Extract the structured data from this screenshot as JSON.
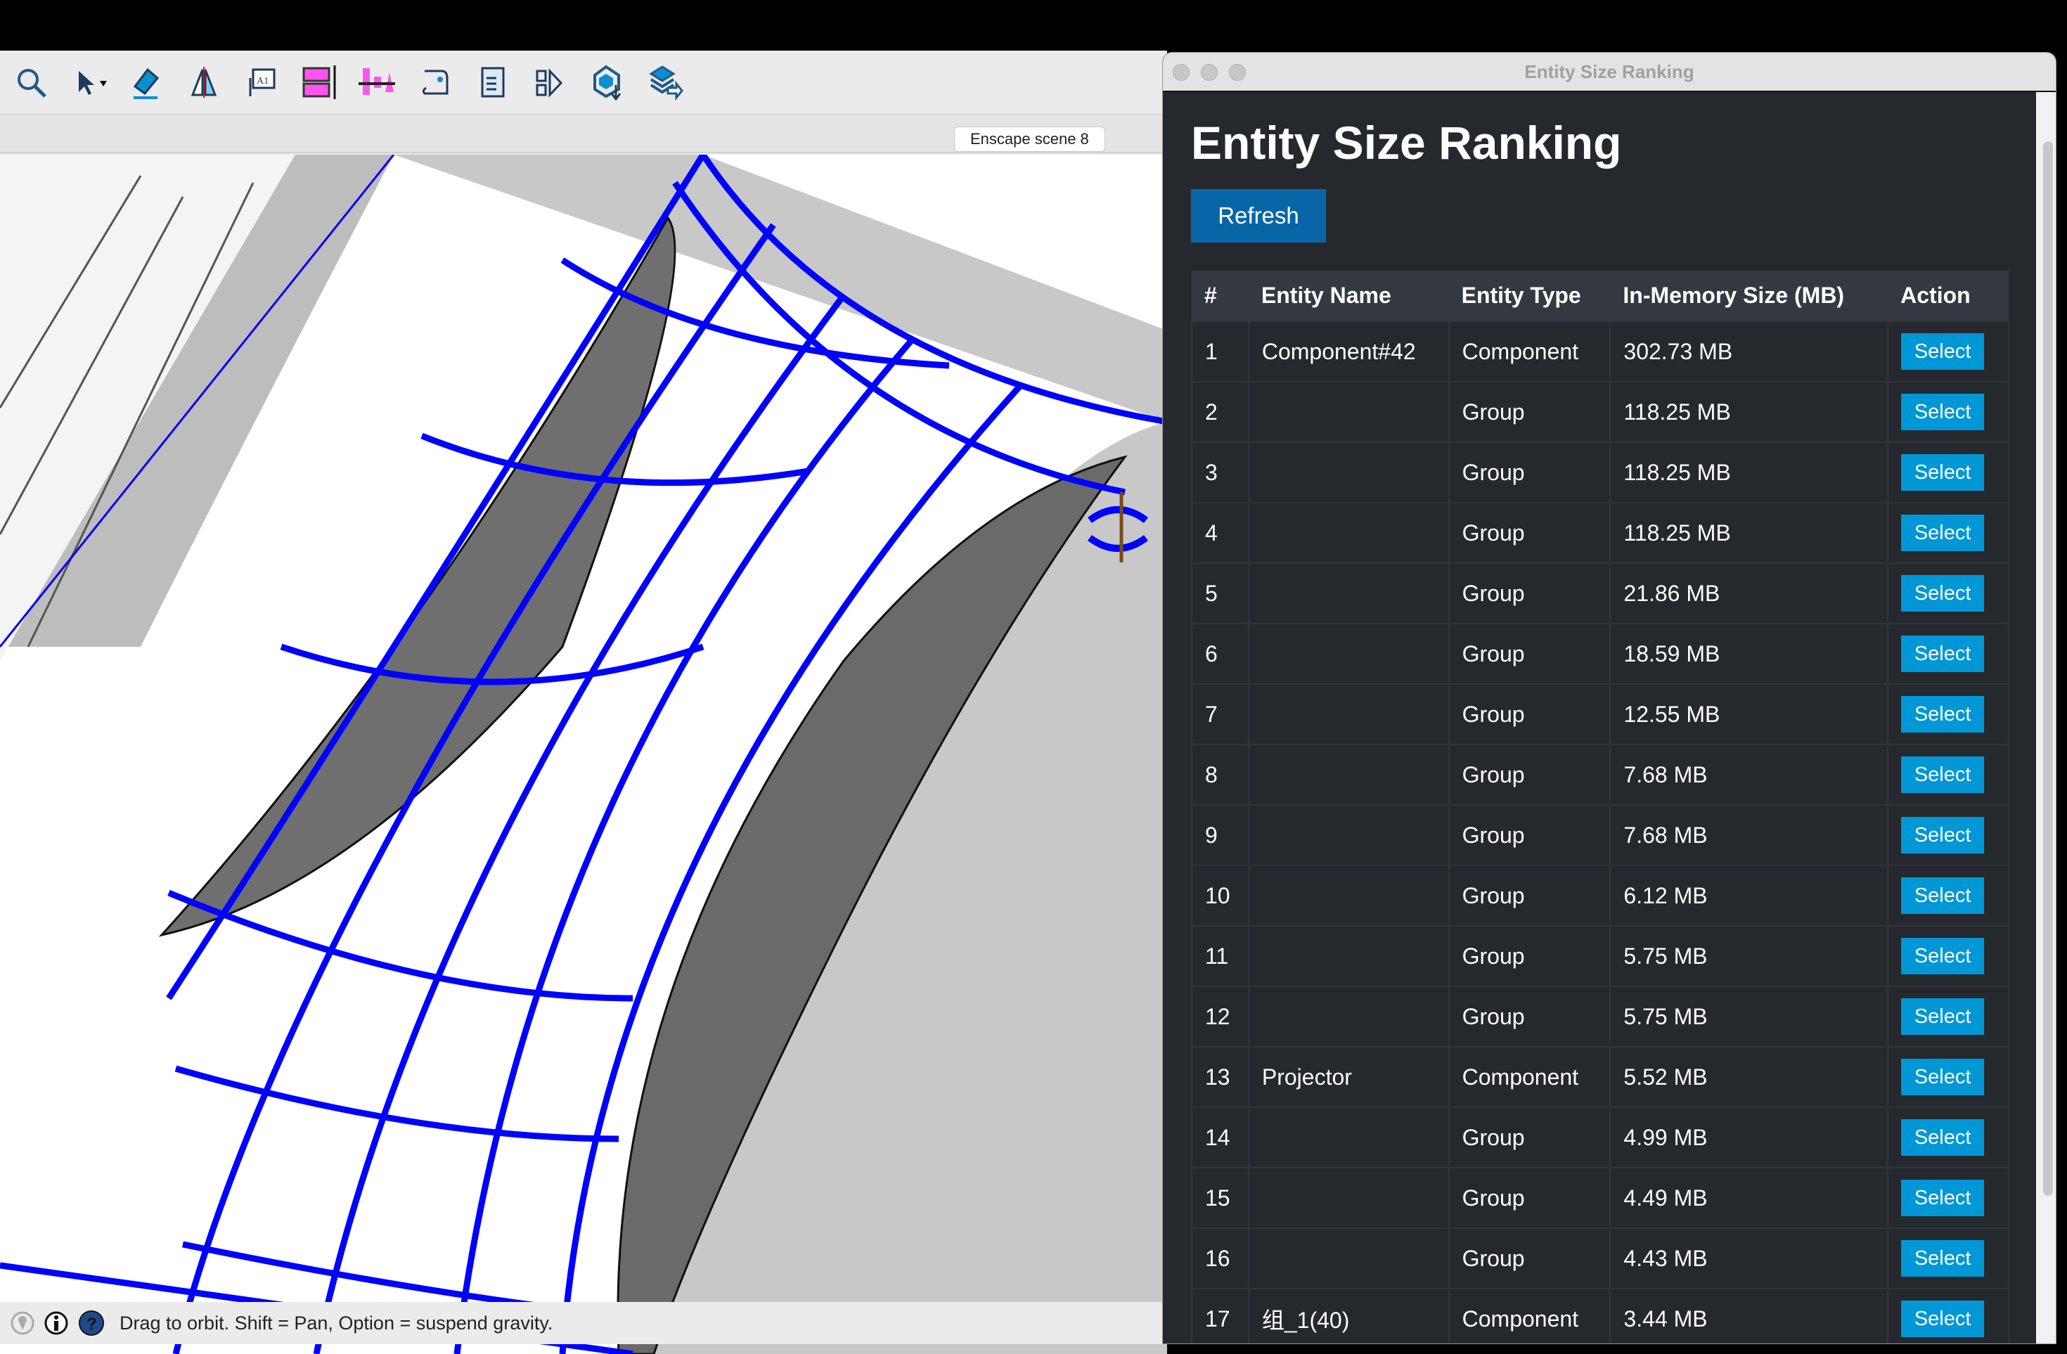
{
  "toolbar": {
    "icons": [
      "zoom-icon",
      "select-arrow-icon",
      "eraser-icon",
      "mirror-icon",
      "text-label-icon",
      "stack-icon",
      "align-icon",
      "path-icon",
      "list-icon",
      "flip-icon",
      "import-component-icon",
      "layers-export-icon"
    ],
    "scene_tag": "Enscape scene 8"
  },
  "status": {
    "text": "Drag to orbit. Shift = Pan, Option = suspend gravity."
  },
  "panel": {
    "window_title": "Entity Size Ranking",
    "heading": "Entity Size Ranking",
    "refresh_label": "Refresh",
    "columns": [
      "#",
      "Entity Name",
      "Entity Type",
      "In-Memory Size (MB)",
      "Action"
    ],
    "rows": [
      {
        "n": "1",
        "name": "Component#42",
        "type": "Component",
        "size": "302.73 MB",
        "action": "Select"
      },
      {
        "n": "2",
        "name": "",
        "type": "Group",
        "size": "118.25 MB",
        "action": "Select"
      },
      {
        "n": "3",
        "name": "",
        "type": "Group",
        "size": "118.25 MB",
        "action": "Select"
      },
      {
        "n": "4",
        "name": "",
        "type": "Group",
        "size": "118.25 MB",
        "action": "Select"
      },
      {
        "n": "5",
        "name": "",
        "type": "Group",
        "size": "21.86 MB",
        "action": "Select"
      },
      {
        "n": "6",
        "name": "",
        "type": "Group",
        "size": "18.59 MB",
        "action": "Select"
      },
      {
        "n": "7",
        "name": "",
        "type": "Group",
        "size": "12.55 MB",
        "action": "Select"
      },
      {
        "n": "8",
        "name": "",
        "type": "Group",
        "size": "7.68 MB",
        "action": "Select"
      },
      {
        "n": "9",
        "name": "",
        "type": "Group",
        "size": "7.68 MB",
        "action": "Select"
      },
      {
        "n": "10",
        "name": "",
        "type": "Group",
        "size": "6.12 MB",
        "action": "Select"
      },
      {
        "n": "11",
        "name": "",
        "type": "Group",
        "size": "5.75 MB",
        "action": "Select"
      },
      {
        "n": "12",
        "name": "",
        "type": "Group",
        "size": "5.75 MB",
        "action": "Select"
      },
      {
        "n": "13",
        "name": "Projector",
        "type": "Component",
        "size": "5.52 MB",
        "action": "Select"
      },
      {
        "n": "14",
        "name": "",
        "type": "Group",
        "size": "4.99 MB",
        "action": "Select"
      },
      {
        "n": "15",
        "name": "",
        "type": "Group",
        "size": "4.49 MB",
        "action": "Select"
      },
      {
        "n": "16",
        "name": "",
        "type": "Group",
        "size": "4.43 MB",
        "action": "Select"
      },
      {
        "n": "17",
        "name": "组_1(40)",
        "type": "Component",
        "size": "3.44 MB",
        "action": "Select"
      }
    ]
  },
  "colors": {
    "panel_bg": "#25292e",
    "header_bg": "#343941",
    "refresh": "#0866a8",
    "select": "#0097d6",
    "model_blue": "#0000ff"
  }
}
